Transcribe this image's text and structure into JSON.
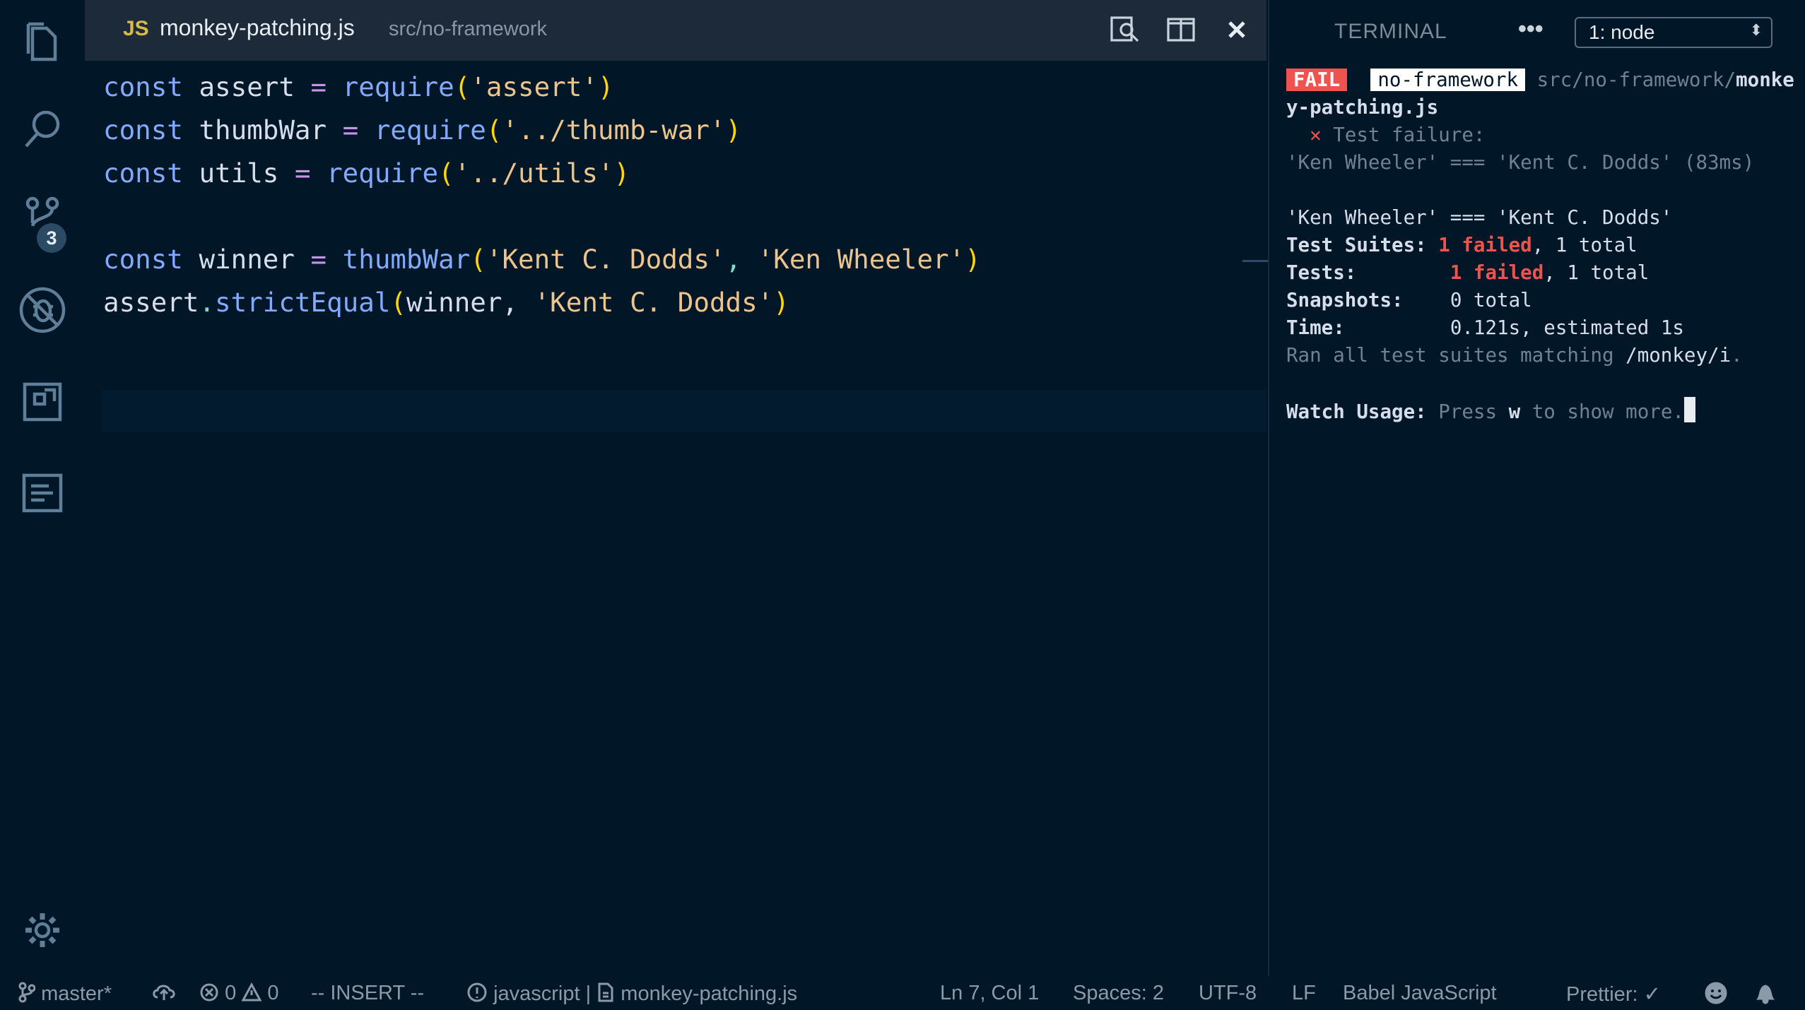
{
  "activity_bar": {
    "icons": [
      "explorer-icon",
      "search-icon",
      "source-control-icon",
      "debug-icon",
      "extensions-icon",
      "output-icon",
      "gear-icon"
    ],
    "scm_badge": "3"
  },
  "editor": {
    "tab": {
      "lang_badge": "JS",
      "filename": "monkey-patching.js",
      "path": "src/no-framework"
    },
    "code_lines": [
      [
        {
          "t": "const",
          "c": "kw"
        },
        {
          "t": " assert ",
          "c": ""
        },
        {
          "t": "=",
          "c": "op"
        },
        {
          "t": " ",
          "c": ""
        },
        {
          "t": "require",
          "c": "fn"
        },
        {
          "t": "(",
          "c": "pn"
        },
        {
          "t": "'assert'",
          "c": "str"
        },
        {
          "t": ")",
          "c": "pn"
        }
      ],
      [
        {
          "t": "const",
          "c": "kw"
        },
        {
          "t": " thumbWar ",
          "c": ""
        },
        {
          "t": "=",
          "c": "op"
        },
        {
          "t": " ",
          "c": ""
        },
        {
          "t": "require",
          "c": "fn"
        },
        {
          "t": "(",
          "c": "pn"
        },
        {
          "t": "'../thumb-war'",
          "c": "str"
        },
        {
          "t": ")",
          "c": "pn"
        }
      ],
      [
        {
          "t": "const",
          "c": "kw"
        },
        {
          "t": " utils ",
          "c": ""
        },
        {
          "t": "=",
          "c": "op"
        },
        {
          "t": " ",
          "c": ""
        },
        {
          "t": "require",
          "c": "fn"
        },
        {
          "t": "(",
          "c": "pn"
        },
        {
          "t": "'../utils'",
          "c": "str"
        },
        {
          "t": ")",
          "c": "pn"
        }
      ],
      [],
      [
        {
          "t": "const",
          "c": "kw"
        },
        {
          "t": " winner ",
          "c": ""
        },
        {
          "t": "=",
          "c": "op"
        },
        {
          "t": " ",
          "c": ""
        },
        {
          "t": "thumbWar",
          "c": "fn"
        },
        {
          "t": "(",
          "c": "pn"
        },
        {
          "t": "'Kent C. Dodds'",
          "c": "str"
        },
        {
          "t": ", ",
          "c": "punc"
        },
        {
          "t": "'Ken Wheeler'",
          "c": "str"
        },
        {
          "t": ")",
          "c": "pn"
        }
      ],
      [
        {
          "t": "assert",
          "c": ""
        },
        {
          "t": ".",
          "c": "punc"
        },
        {
          "t": "strictEqual",
          "c": "fn"
        },
        {
          "t": "(",
          "c": "pn"
        },
        {
          "t": "winner, ",
          "c": ""
        },
        {
          "t": "'Kent C. Dodds'",
          "c": "str"
        },
        {
          "t": ")",
          "c": "pn"
        }
      ]
    ]
  },
  "terminal": {
    "title": "TERMINAL",
    "more": "•••",
    "selected_terminal": "1: node",
    "fail_badge": "FAIL",
    "project_badge": "no-framework",
    "path_prefix": "src/no-framework/",
    "path_file_start": "monke",
    "path_file_end": "y-patching.js",
    "failure_mark": "✕",
    "failure_title": "Test failure:",
    "failure_detail": "'Ken Wheeler' === 'Kent C. Dodds' (83ms)",
    "assertion": "'Ken Wheeler' === 'Kent C. Dodds'",
    "suites_label": "Test Suites:",
    "suites_failed": "1 failed",
    "suites_total": ", 1 total",
    "tests_label": "Tests:",
    "tests_failed": "1 failed",
    "tests_total": ", 1 total",
    "snapshots_label": "Snapshots:",
    "snapshots_value": "0 total",
    "time_label": "Time:",
    "time_value": "0.121s, estimated 1s",
    "ran_text": "Ran all test suites matching ",
    "ran_pattern": "/monkey/i",
    "ran_end": ".",
    "watch_label": "Watch Usage:",
    "watch_press": "Press ",
    "watch_key": "w",
    "watch_rest": " to show more."
  },
  "status_bar": {
    "branch": "master*",
    "errors": "0",
    "warnings": "0",
    "mode": "-- INSERT --",
    "language_info": "javascript",
    "separator": "|",
    "file": "monkey-patching.js",
    "position": "Ln 7, Col 1",
    "spaces": "Spaces: 2",
    "encoding": "UTF-8",
    "eol": "LF",
    "language": "Babel JavaScript",
    "prettier": "Prettier: ✓"
  },
  "colors": {
    "background": "#011627",
    "keyword": "#82aaff",
    "string": "#ecc48d",
    "fail": "#ef5350"
  }
}
